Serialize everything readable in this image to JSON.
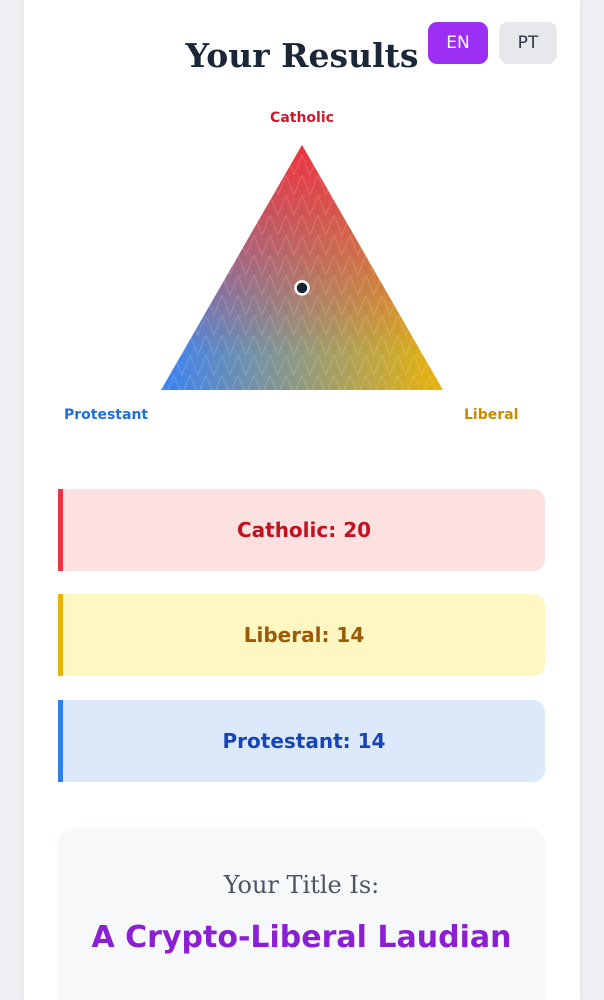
{
  "language_buttons": [
    {
      "label": "EN",
      "active": true,
      "color": "#9d2ff5"
    },
    {
      "label": "PT",
      "active": false,
      "color": "#e6e8ec"
    }
  ],
  "header": {
    "title": "Your Results"
  },
  "triangle": {
    "labels": {
      "top": "Catholic",
      "left": "Protestant",
      "right": "Liberal"
    },
    "colors": {
      "catholic": "#ef3340",
      "protestant": "#3b82f6",
      "liberal": "#eab308"
    }
  },
  "scores": [
    {
      "label": "Catholic: 20",
      "name": "Catholic",
      "value": 20
    },
    {
      "label": "Liberal: 14",
      "name": "Liberal",
      "value": 14
    },
    {
      "label": "Protestant: 14",
      "name": "Protestant",
      "value": 14
    }
  ],
  "result": {
    "heading": "Your Title Is:",
    "title": "A Crypto-Liberal Laudian"
  }
}
